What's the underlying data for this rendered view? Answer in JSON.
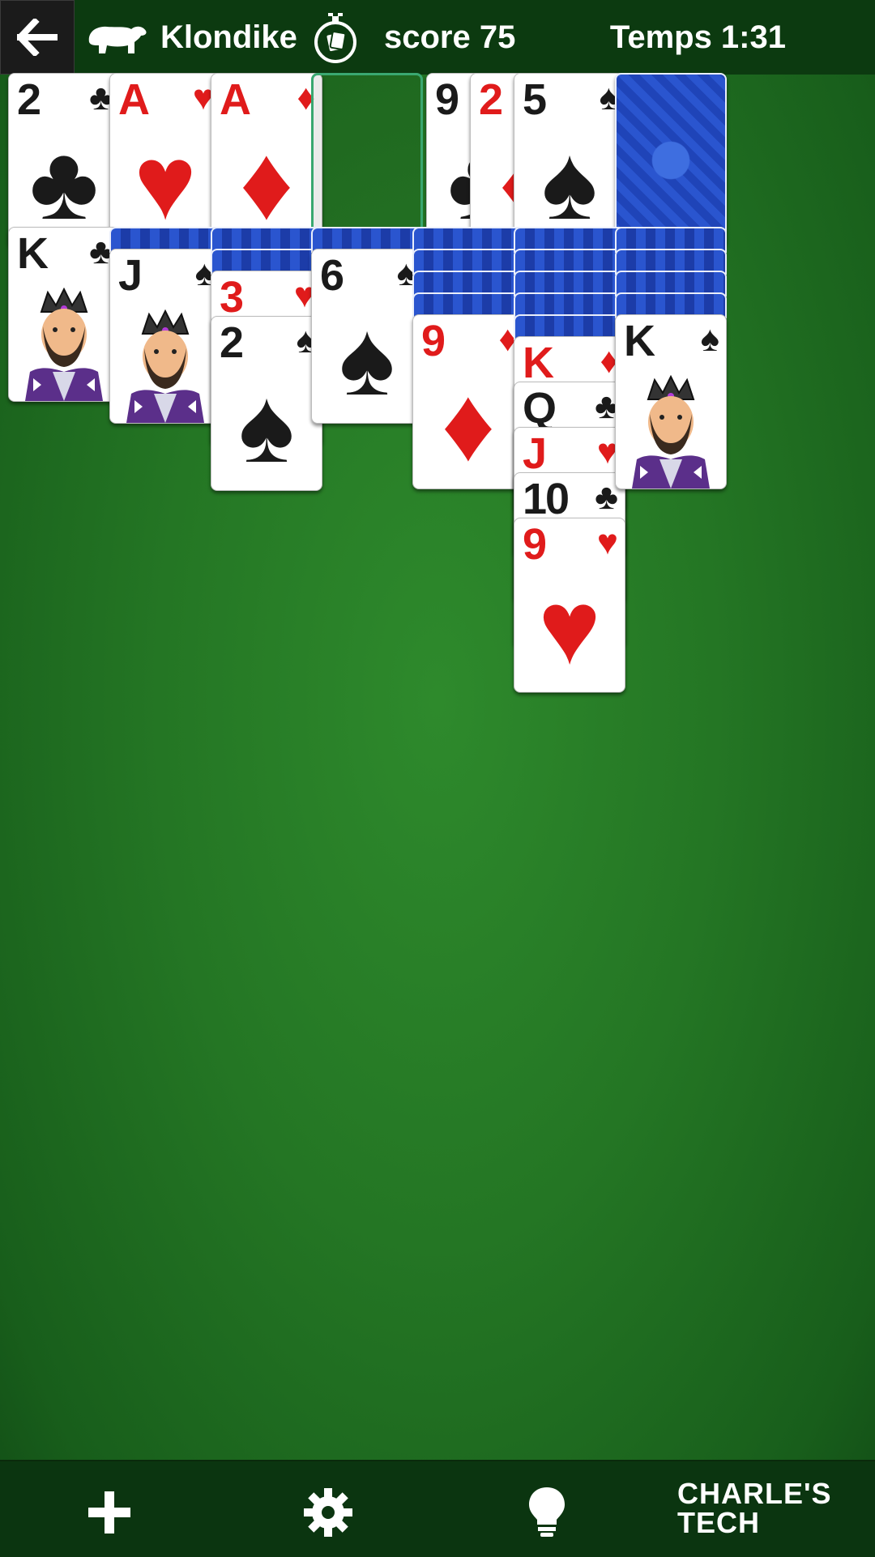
{
  "header": {
    "game_name": "Klondike",
    "score_text": "score 75",
    "time_text": "Temps 1:31",
    "back_icon": "back-arrow-icon",
    "mode_icon": "polar-bear-icon",
    "timer_icon": "stopwatch-icon"
  },
  "foundations": [
    {
      "rank": "2",
      "suit": "♣",
      "color": "black"
    },
    {
      "rank": "A",
      "suit": "♥",
      "color": "red"
    },
    {
      "rank": "A",
      "suit": "♦",
      "color": "red"
    },
    {
      "empty": true
    }
  ],
  "waste": [
    {
      "rank": "9",
      "suit": "♣",
      "color": "black"
    },
    {
      "rank": "2",
      "suit": "♦",
      "color": "red"
    },
    {
      "rank": "5",
      "suit": "♠",
      "color": "black"
    }
  ],
  "stock": {
    "face_down": true
  },
  "tableau": [
    {
      "face_down": 0,
      "cards": [
        {
          "rank": "K",
          "suit": "♣",
          "color": "black",
          "face": true
        }
      ]
    },
    {
      "face_down": 1,
      "cards": [
        {
          "rank": "J",
          "suit": "♠",
          "color": "black",
          "face": true
        }
      ]
    },
    {
      "face_down": 2,
      "cards": [
        {
          "rank": "3",
          "suit": "♥",
          "color": "red"
        },
        {
          "rank": "2",
          "suit": "♠",
          "color": "black"
        }
      ]
    },
    {
      "face_down": 1,
      "cards": [
        {
          "rank": "6",
          "suit": "♠",
          "color": "black"
        }
      ]
    },
    {
      "face_down": 4,
      "cards": [
        {
          "rank": "9",
          "suit": "♦",
          "color": "red"
        }
      ]
    },
    {
      "face_down": 5,
      "cards": [
        {
          "rank": "K",
          "suit": "♦",
          "color": "red"
        },
        {
          "rank": "Q",
          "suit": "♣",
          "color": "black"
        },
        {
          "rank": "J",
          "suit": "♥",
          "color": "red"
        },
        {
          "rank": "10",
          "suit": "♣",
          "color": "black"
        },
        {
          "rank": "9",
          "suit": "♥",
          "color": "red"
        }
      ]
    },
    {
      "face_down": 4,
      "cards": [
        {
          "rank": "K",
          "suit": "♠",
          "color": "black",
          "face": true
        }
      ]
    }
  ],
  "bottom_bar": {
    "new_game_icon": "plus-icon",
    "settings_icon": "gear-icon",
    "hint_icon": "lightbulb-icon",
    "watermark_line1": "CHARLE'S",
    "watermark_line2": "TECH"
  },
  "colors": {
    "table_green": "#247624",
    "red_suit": "#e01b1b",
    "card_back": "#1c3fb0",
    "bar": "#0c3a10"
  }
}
